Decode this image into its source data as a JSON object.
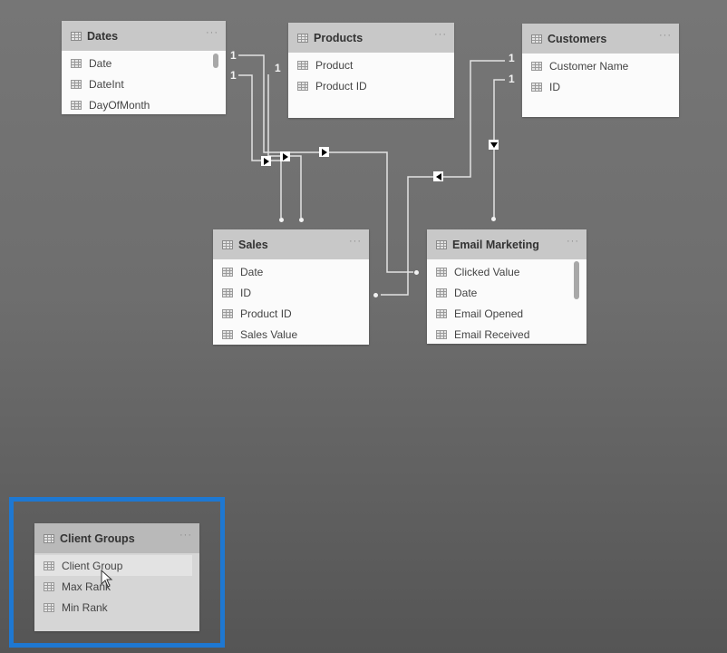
{
  "tables": {
    "dates": {
      "title": "Dates",
      "more": "···",
      "fields": [
        "Date",
        "DateInt",
        "DayOfMonth"
      ]
    },
    "products": {
      "title": "Products",
      "more": "···",
      "fields": [
        "Product",
        "Product ID"
      ]
    },
    "customers": {
      "title": "Customers",
      "more": "···",
      "fields": [
        "Customer Name",
        "ID"
      ]
    },
    "sales": {
      "title": "Sales",
      "more": "···",
      "fields": [
        "Date",
        "ID",
        "Product ID",
        "Sales Value"
      ]
    },
    "email_marketing": {
      "title": "Email Marketing",
      "more": "···",
      "fields": [
        "Clicked Value",
        "Date",
        "Email Opened",
        "Email Received"
      ]
    },
    "client_groups": {
      "title": "Client Groups",
      "more": "···",
      "fields": [
        "Client Group",
        "Max Rank",
        "Min Rank"
      ]
    }
  },
  "relationships": [
    {
      "from": "Dates.Date",
      "to": "Email Marketing.Date",
      "cardinality_one": "1",
      "direction": "right"
    },
    {
      "from": "Dates.DateInt",
      "to": "Sales.Date",
      "cardinality_one": "1",
      "direction": "right"
    },
    {
      "from": "Products.Product ID",
      "to": "Sales.Product ID",
      "cardinality_one": "1",
      "direction": "right"
    },
    {
      "from": "Customers.Customer Name",
      "to": "Sales.ID",
      "cardinality_one": "1",
      "direction": "left"
    },
    {
      "from": "Customers.ID",
      "to": "Email Marketing",
      "cardinality_one": "1",
      "direction": "down"
    }
  ],
  "colors": {
    "highlight": "#1e78d2",
    "line": "#e6e6e6"
  },
  "icons": {
    "table": "table-grid-icon",
    "field": "field-grid-icon",
    "cursor": "mouse-pointer-icon"
  }
}
